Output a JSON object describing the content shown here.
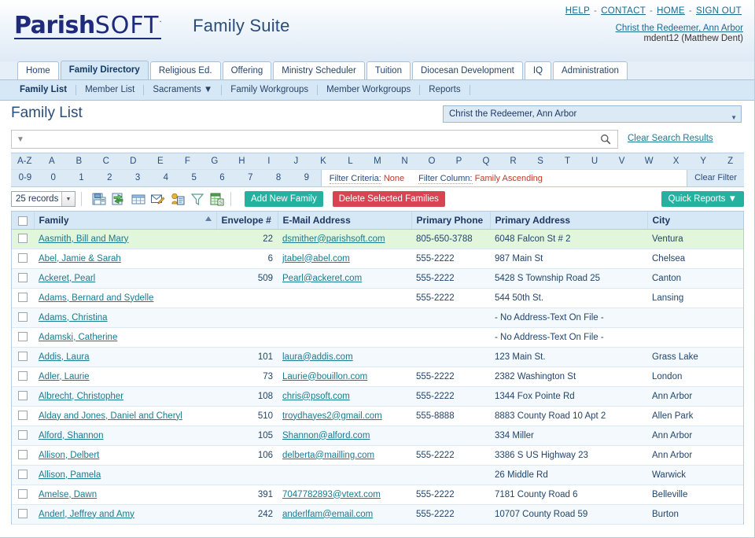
{
  "header": {
    "logo_part1": "Parish",
    "logo_part2": "SOFT",
    "logo_tm": "·",
    "suite_title": "Family Suite",
    "links": [
      {
        "label": "HELP",
        "name": "help-link"
      },
      {
        "label": "CONTACT",
        "name": "contact-link"
      },
      {
        "label": "HOME",
        "name": "home-link"
      },
      {
        "label": "SIGN OUT",
        "name": "sign-out-link"
      }
    ],
    "separator": "-",
    "org_link": "Christ the Redeemer, Ann Arbor",
    "username": "mdent12 (Matthew Dent)"
  },
  "tabs": [
    {
      "label": "Home",
      "active": false
    },
    {
      "label": "Family Directory",
      "active": true
    },
    {
      "label": "Religious Ed.",
      "active": false
    },
    {
      "label": "Offering",
      "active": false
    },
    {
      "label": "Ministry Scheduler",
      "active": false
    },
    {
      "label": "Tuition",
      "active": false
    },
    {
      "label": "Diocesan Development",
      "active": false
    },
    {
      "label": "IQ",
      "active": false
    },
    {
      "label": "Administration",
      "active": false
    }
  ],
  "subnav": [
    {
      "label": "Family List",
      "active": true
    },
    {
      "label": "Member List",
      "active": false
    },
    {
      "label": "Sacraments ▼",
      "active": false
    },
    {
      "label": "Family Workgroups",
      "active": false
    },
    {
      "label": "Member Workgroups",
      "active": false
    },
    {
      "label": "Reports",
      "active": false
    }
  ],
  "page": {
    "title": "Family List",
    "parish_selected": "Christ the Redeemer, Ann Arbor"
  },
  "search": {
    "value": "",
    "placeholder": "",
    "clear_label": "Clear Search Results"
  },
  "alpha": {
    "letters": [
      "A-Z",
      "A",
      "B",
      "C",
      "D",
      "E",
      "F",
      "G",
      "H",
      "I",
      "J",
      "K",
      "L",
      "M",
      "N",
      "O",
      "P",
      "Q",
      "R",
      "S",
      "T",
      "U",
      "V",
      "W",
      "X",
      "Y",
      "Z"
    ],
    "numbers": [
      "0-9",
      "0",
      "1",
      "2",
      "3",
      "4",
      "5",
      "6",
      "7",
      "8",
      "9"
    ],
    "filter_criteria_label": "Filter Criteria:",
    "filter_criteria_value": "None",
    "filter_column_label": "Filter Column:",
    "filter_column_value": "Family Ascending",
    "clear_filter_label": "Clear Filter"
  },
  "toolbar": {
    "records_label": "25 records",
    "icons": [
      "save-icon",
      "export-refresh-icon",
      "grid-view-icon",
      "mail-merge-icon",
      "contact-card-icon",
      "funnel-filter-icon",
      "excel-export-icon"
    ],
    "add_label": "Add New Family",
    "delete_label": "Delete Selected Families",
    "quick_reports_label": "Quick Reports ▼"
  },
  "colors": {
    "accent_teal": "#26b0a0",
    "danger_red": "#d94453",
    "link_teal": "#1a7a8f",
    "header_blue": "#d6e7f5",
    "selected_row_green": "#e2f6dc",
    "filter_value_red": "#c0392b"
  },
  "table": {
    "columns": [
      {
        "key": "check",
        "label": ""
      },
      {
        "key": "family",
        "label": "Family",
        "sorted": true
      },
      {
        "key": "envelope",
        "label": "Envelope #"
      },
      {
        "key": "email",
        "label": "E-Mail Address"
      },
      {
        "key": "phone",
        "label": "Primary Phone"
      },
      {
        "key": "address",
        "label": "Primary Address"
      },
      {
        "key": "city",
        "label": "City"
      }
    ],
    "rows": [
      {
        "family": "Aasmith, Bill and Mary",
        "envelope": "22",
        "email": "dsmither@parishsoft.com",
        "phone": "805-650-3788",
        "address": "6048 Falcon St # 2",
        "city": "Ventura",
        "selected": true
      },
      {
        "family": "Abel, Jamie & Sarah",
        "envelope": "6",
        "email": "jtabel@abel.com",
        "phone": "555-2222",
        "address": "987 Main St",
        "city": "Chelsea",
        "selected": false
      },
      {
        "family": "Ackeret, Pearl",
        "envelope": "509",
        "email": "Pearl@ackeret.com",
        "phone": "555-2222",
        "address": "5428 S Township Road 25",
        "city": "Canton",
        "selected": false
      },
      {
        "family": "Adams, Bernard and Sydelle",
        "envelope": "",
        "email": "",
        "phone": "555-2222",
        "address": "544 50th St.",
        "city": "Lansing",
        "selected": false
      },
      {
        "family": "Adams, Christina",
        "envelope": "",
        "email": "",
        "phone": "",
        "address": "- No Address-Text On File -",
        "city": "",
        "selected": false
      },
      {
        "family": "Adamski, Catherine",
        "envelope": "",
        "email": "",
        "phone": "",
        "address": "- No Address-Text On File -",
        "city": "",
        "selected": false
      },
      {
        "family": "Addis, Laura",
        "envelope": "101",
        "email": "laura@addis.com",
        "phone": "",
        "address": "123 Main St.",
        "city": "Grass Lake",
        "selected": false
      },
      {
        "family": "Adler, Laurie",
        "envelope": "73",
        "email": "Laurie@bouillon.com",
        "phone": "555-2222",
        "address": "2382 Washington St",
        "city": "London",
        "selected": false
      },
      {
        "family": "Albrecht, Christopher",
        "envelope": "108",
        "email": "chris@psoft.com",
        "phone": "555-2222",
        "address": "1344 Fox Pointe Rd",
        "city": "Ann Arbor",
        "selected": false
      },
      {
        "family": "Alday and Jones, Daniel and Cheryl",
        "envelope": "510",
        "email": "troydhayes2@gmail.com",
        "phone": "555-8888",
        "address": "8883 County Road 10 Apt 2",
        "city": "Allen Park",
        "selected": false
      },
      {
        "family": "Alford, Shannon",
        "envelope": "105",
        "email": "Shannon@alford.com",
        "phone": "",
        "address": "334 Miller",
        "city": "Ann Arbor",
        "selected": false
      },
      {
        "family": "Allison, Delbert",
        "envelope": "106",
        "email": "delberta@mailling.com",
        "phone": "555-2222",
        "address": "3386 S US Highway 23",
        "city": "Ann Arbor",
        "selected": false
      },
      {
        "family": "Allison, Pamela",
        "envelope": "",
        "email": "",
        "phone": "",
        "address": "26 Middle Rd",
        "city": "Warwick",
        "selected": false
      },
      {
        "family": "Amelse, Dawn",
        "envelope": "391",
        "email": "7047782893@vtext.com",
        "phone": "555-2222",
        "address": "7181 County Road 6",
        "city": "Belleville",
        "selected": false
      },
      {
        "family": "Anderl, Jeffrey and Amy",
        "envelope": "242",
        "email": "anderlfam@email.com",
        "phone": "555-2222",
        "address": "10707 County Road 59",
        "city": "Burton",
        "selected": false
      }
    ]
  }
}
